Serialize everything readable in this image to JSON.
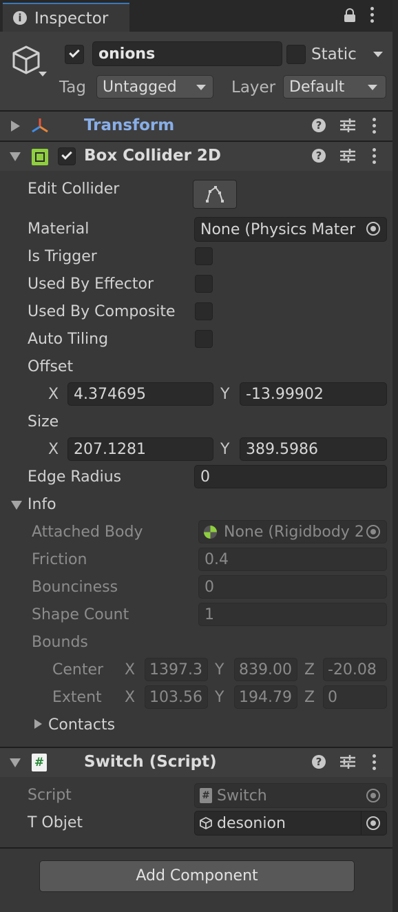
{
  "window": {
    "tab_title": "Inspector"
  },
  "header": {
    "object_name": "onions",
    "static_label": "Static",
    "tag_label": "Tag",
    "tag_value": "Untagged",
    "layer_label": "Layer",
    "layer_value": "Default"
  },
  "components": {
    "transform": {
      "title": "Transform"
    },
    "box_collider": {
      "title": "Box Collider 2D",
      "edit_collider": "Edit Collider",
      "material_label": "Material",
      "material_value": "None (Physics Mater",
      "is_trigger": "Is Trigger",
      "used_by_effector": "Used By Effector",
      "used_by_composite": "Used By Composite",
      "auto_tiling": "Auto Tiling",
      "offset_label": "Offset",
      "offset_x": "4.374695",
      "offset_y": "-13.99902",
      "size_label": "Size",
      "size_x": "207.1281",
      "size_y": "389.5986",
      "edge_radius_label": "Edge Radius",
      "edge_radius_value": "0",
      "info_label": "Info",
      "attached_body_label": "Attached Body",
      "attached_body_value": "None (Rigidbody 2",
      "friction_label": "Friction",
      "friction_value": "0.4",
      "bounciness_label": "Bounciness",
      "bounciness_value": "0",
      "shape_count_label": "Shape Count",
      "shape_count_value": "1",
      "bounds_label": "Bounds",
      "center_label": "Center",
      "center_x": "1397.3",
      "center_y": "839.00",
      "center_z": "-20.08",
      "extent_label": "Extent",
      "extent_x": "103.56",
      "extent_y": "194.79",
      "extent_z": "0",
      "contacts_label": "Contacts"
    },
    "switch_script": {
      "title": "Switch (Script)",
      "script_label": "Script",
      "script_value": "Switch",
      "t_objet_label": "T Objet",
      "t_objet_value": "desonion"
    }
  },
  "axis": {
    "x": "X",
    "y": "Y",
    "z": "Z"
  },
  "add_component_label": "Add Component",
  "colors": {
    "background": "#383838",
    "header_bg": "#3e3e3e",
    "field_bg": "#2a2a2a",
    "transform_title": "#88aee8",
    "collider_icon": "#8fcf3f",
    "tab_accent": "#3a79bb"
  }
}
